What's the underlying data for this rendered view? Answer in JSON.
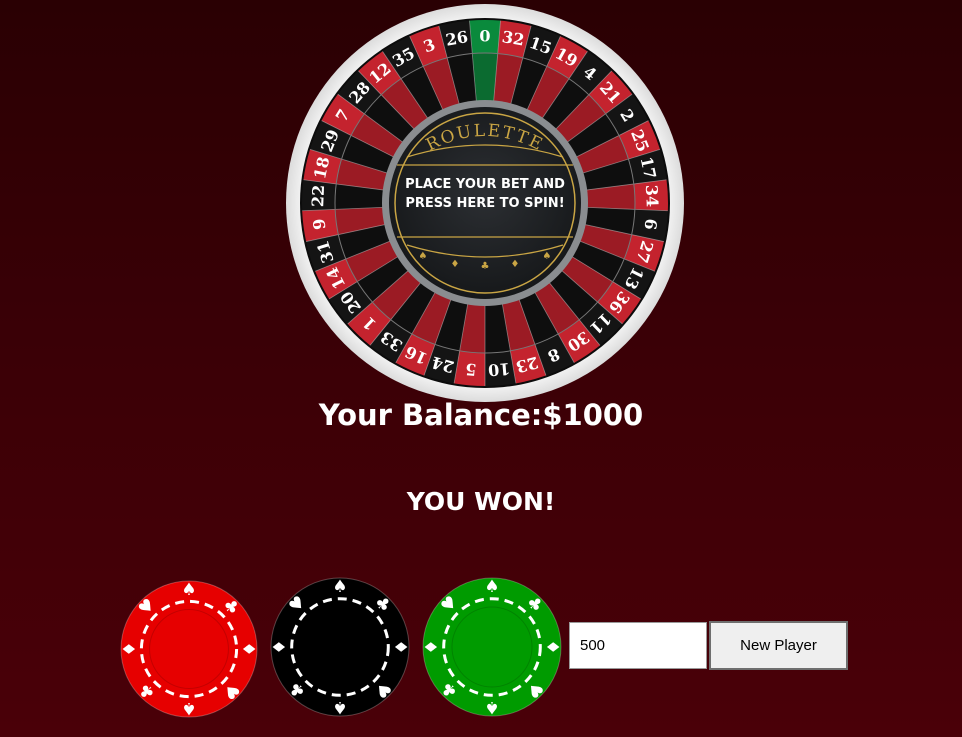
{
  "wheel": {
    "numbers": [
      "0",
      "32",
      "15",
      "19",
      "4",
      "21",
      "2",
      "25",
      "17",
      "34",
      "6",
      "27",
      "13",
      "36",
      "11",
      "30",
      "8",
      "23",
      "10",
      "5",
      "24",
      "16",
      "33",
      "1",
      "20",
      "14",
      "31",
      "9",
      "22",
      "18",
      "29",
      "7",
      "28",
      "12",
      "35",
      "3",
      "26"
    ],
    "title": "ROULETTE",
    "prompt": "PLACE YOUR BET AND PRESS HERE TO SPIN!",
    "colors": {
      "red": "#c4232e",
      "black": "#141414",
      "green": "#0a8a3c",
      "gold": "#c9a544"
    }
  },
  "balance_text": "Your Balance:$1000",
  "result_text": "YOU WON!",
  "chips": [
    {
      "name": "red",
      "color": "#e60000"
    },
    {
      "name": "black",
      "color": "#000000"
    },
    {
      "name": "green",
      "color": "#009b00"
    }
  ],
  "bet_input": {
    "value": "500"
  },
  "new_player_label": "New Player"
}
